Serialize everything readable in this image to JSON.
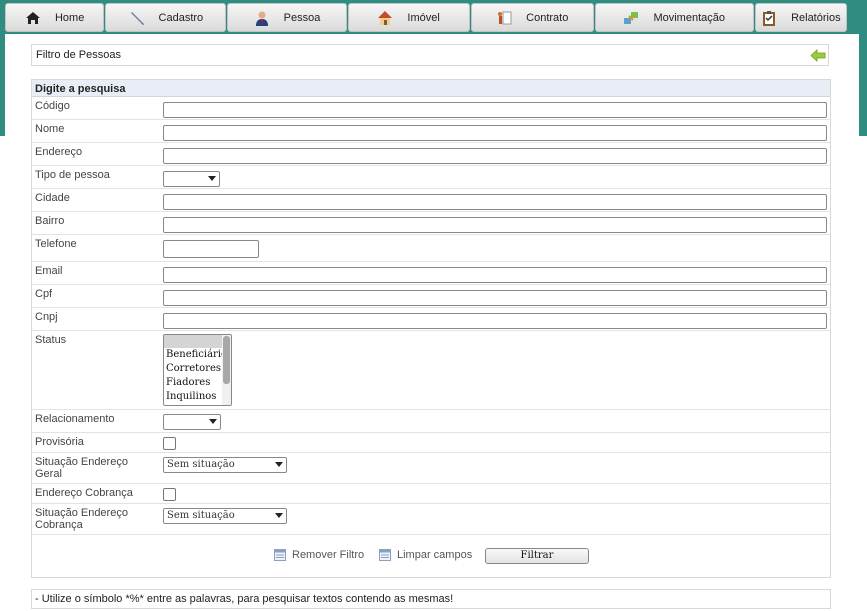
{
  "menu": [
    {
      "label": "Home",
      "icon": "home-icon"
    },
    {
      "label": "Cadastro",
      "icon": "pencil-icon"
    },
    {
      "label": "Pessoa",
      "icon": "person-icon"
    },
    {
      "label": "Imóvel",
      "icon": "house-icon"
    },
    {
      "label": "Contrato",
      "icon": "contract-icon"
    },
    {
      "label": "Movimentação",
      "icon": "transfer-icon"
    },
    {
      "label": "Relatórios",
      "icon": "clipboard-icon"
    }
  ],
  "title": "Filtro de Pessoas",
  "form": {
    "heading": "Digite a pesquisa",
    "fields": {
      "codigo": {
        "label": "Código",
        "value": ""
      },
      "nome": {
        "label": "Nome",
        "value": ""
      },
      "endereco": {
        "label": "Endereço",
        "value": ""
      },
      "tipo_pessoa": {
        "label": "Tipo de pessoa",
        "selected": ""
      },
      "cidade": {
        "label": "Cidade",
        "value": ""
      },
      "bairro": {
        "label": "Bairro",
        "value": ""
      },
      "telefone": {
        "label": "Telefone",
        "value": ""
      },
      "email": {
        "label": "Email",
        "value": ""
      },
      "cpf": {
        "label": "Cpf",
        "value": ""
      },
      "cnpj": {
        "label": "Cnpj",
        "value": ""
      },
      "status": {
        "label": "Status",
        "options": [
          "",
          "Beneficiário",
          "Corretores",
          "Fiadores",
          "Inquilinos"
        ]
      },
      "relacionamento": {
        "label": "Relacionamento",
        "selected": ""
      },
      "provisoria": {
        "label": "Provisória",
        "checked": false
      },
      "situacao_endereco_geral": {
        "label": "Situação Endereço Geral",
        "selected": "Sem situação"
      },
      "endereco_cobranca": {
        "label": "Endereço Cobrança",
        "checked": false
      },
      "situacao_endereco_cobranca": {
        "label": "Situação Endereço Cobrança",
        "selected": "Sem situação"
      }
    }
  },
  "actions": {
    "remover_filtro": "Remover Filtro",
    "limpar_campos": "Limpar campos",
    "filtrar": "Filtrar"
  },
  "note": "- Utilize o símbolo *%* entre as palavras, para pesquisar textos contendo as mesmas!",
  "colors": {
    "header_band": "#2e8c80",
    "form_header": "#e8edf6"
  }
}
